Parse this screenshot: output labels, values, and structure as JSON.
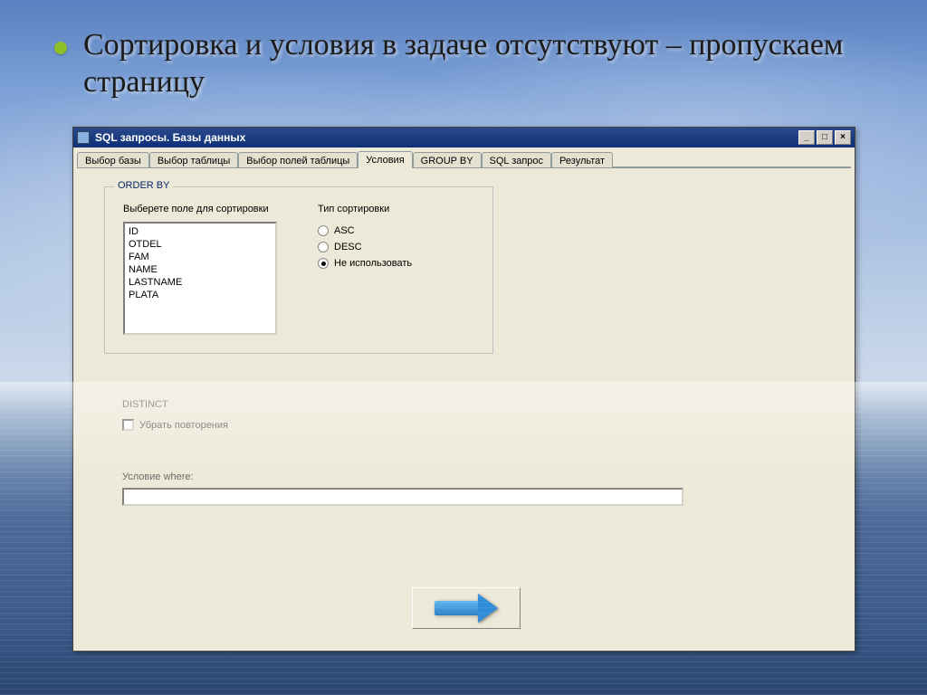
{
  "slide": {
    "bullet_text": "Сортировка и условия в задаче отсутствуют – пропускаем страницу"
  },
  "window": {
    "title": "SQL запросы. Базы данных",
    "tabs": [
      "Выбор базы",
      "Выбор таблицы",
      "Выбор полей таблицы",
      "Условия",
      "GROUP BY",
      "SQL запрос",
      "Результат"
    ],
    "active_tab_index": 3
  },
  "orderby": {
    "legend": "ORDER BY",
    "field_label": "Выберете поле для сортировки",
    "sort_type_label": "Тип сортировки",
    "fields": [
      "ID",
      "OTDEL",
      "FAM",
      "NAME",
      "LASTNAME",
      "PLATA"
    ],
    "radios": [
      {
        "label": "ASC",
        "selected": false
      },
      {
        "label": "DESC",
        "selected": false
      },
      {
        "label": "Не использовать",
        "selected": true
      }
    ]
  },
  "distinct": {
    "heading": "DISTINCT",
    "checkbox_label": "Убрать повторения",
    "checked": false
  },
  "where": {
    "label": "Условие where:",
    "value": ""
  }
}
